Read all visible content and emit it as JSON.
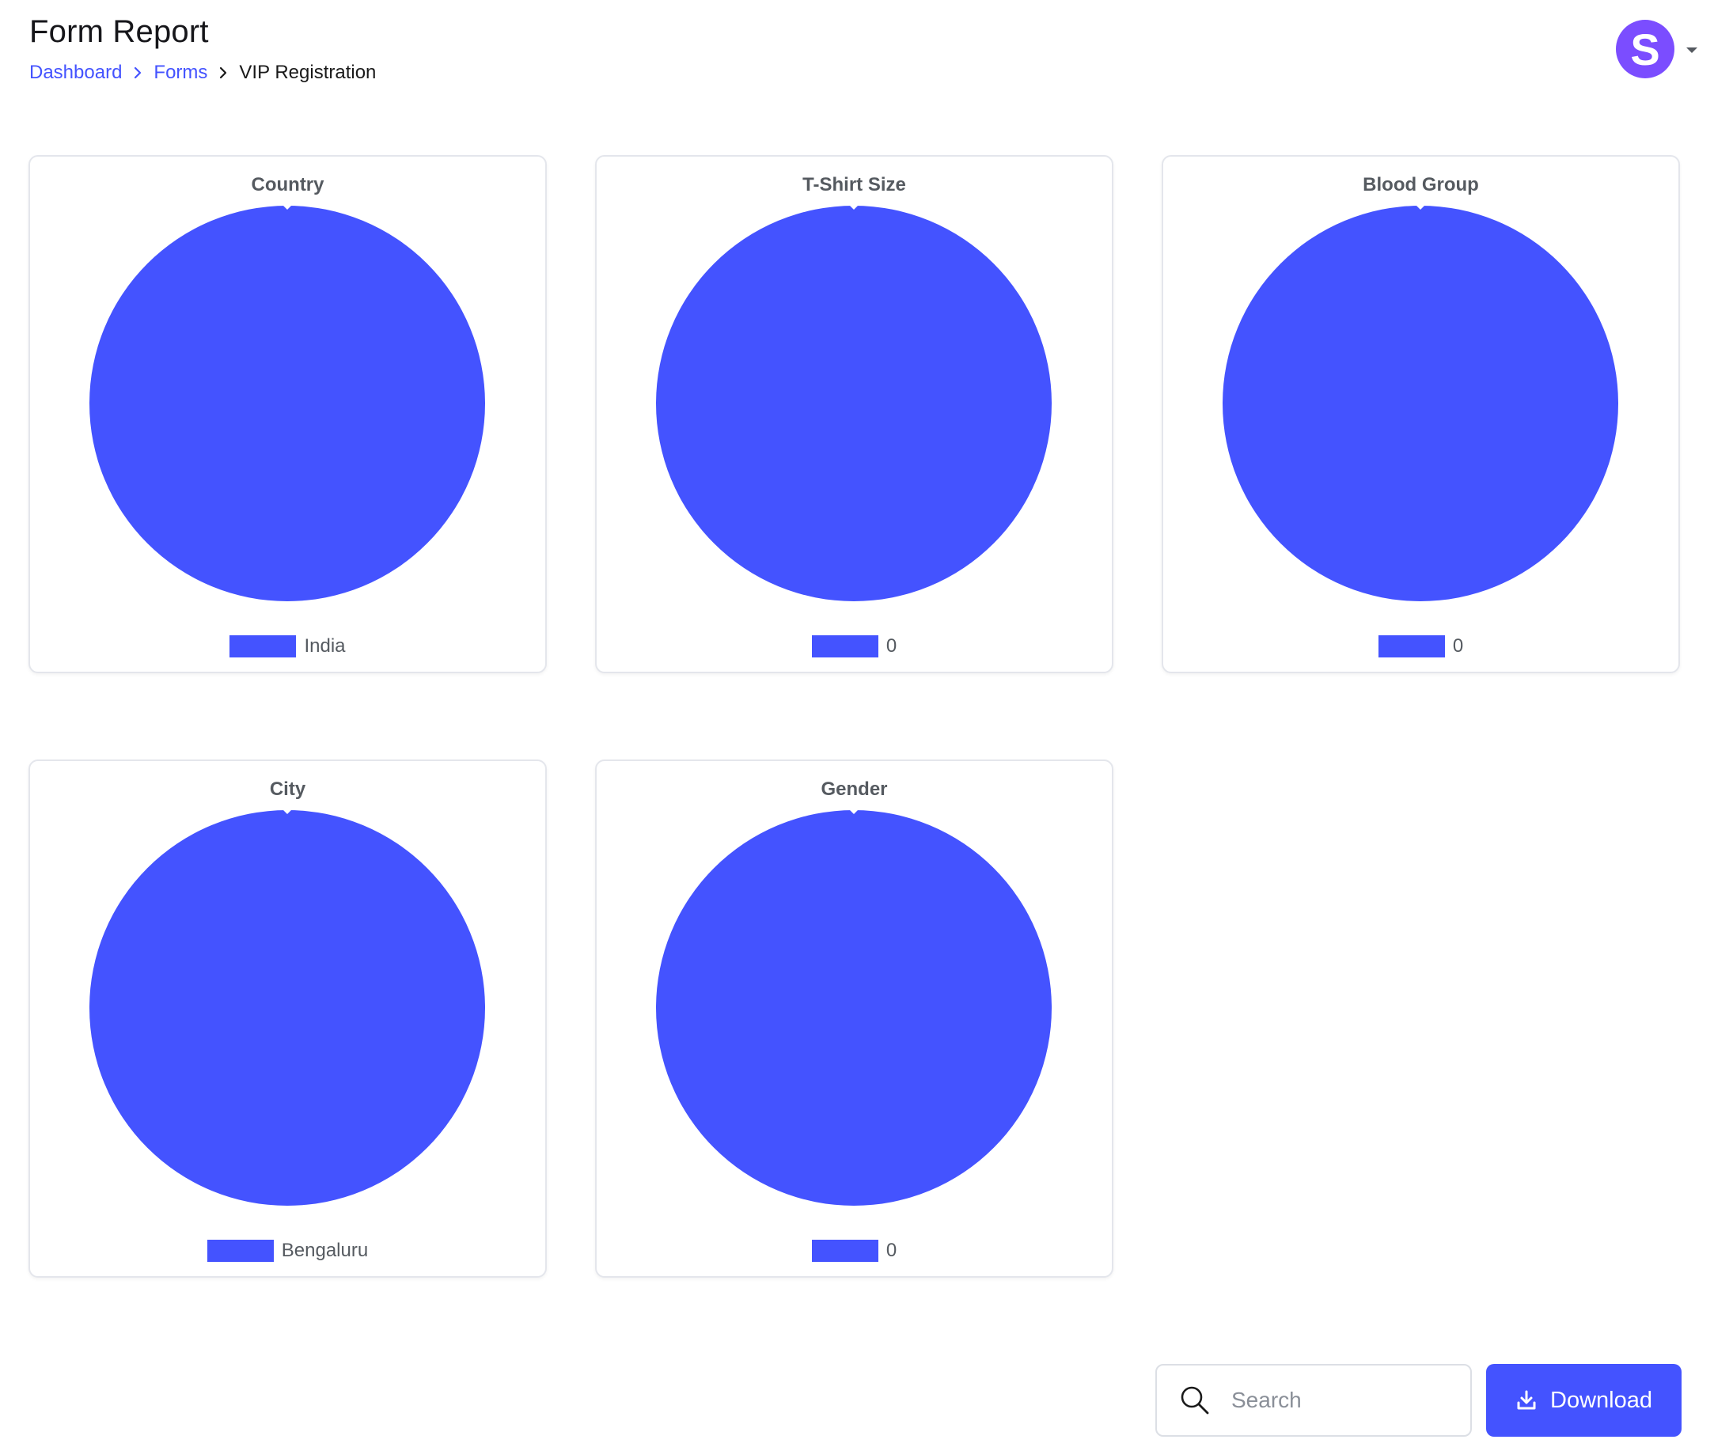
{
  "header": {
    "title": "Form Report",
    "breadcrumb": [
      "Dashboard",
      "Forms",
      "VIP Registration"
    ]
  },
  "user": {
    "avatar_initial": "S",
    "avatar_color": "#7b4dff"
  },
  "theme": {
    "accent": "#4453ff",
    "pie_color": "#4453ff",
    "card_title_color": "#555a60"
  },
  "chart_data": [
    {
      "type": "pie",
      "title": "Country",
      "labels": [
        "India"
      ],
      "values": [
        1
      ],
      "legend": "bottom"
    },
    {
      "type": "pie",
      "title": "T-Shirt Size",
      "labels": [
        "0"
      ],
      "values": [
        1
      ],
      "legend": "bottom"
    },
    {
      "type": "pie",
      "title": "Blood Group",
      "labels": [
        "0"
      ],
      "values": [
        1
      ],
      "legend": "bottom"
    },
    {
      "type": "pie",
      "title": "City",
      "labels": [
        "Bengaluru"
      ],
      "values": [
        1
      ],
      "legend": "bottom"
    },
    {
      "type": "pie",
      "title": "Gender",
      "labels": [
        "0"
      ],
      "values": [
        1
      ],
      "legend": "bottom"
    }
  ],
  "toolbar": {
    "search_placeholder": "Search",
    "search_value": "",
    "download_label": "Download"
  }
}
